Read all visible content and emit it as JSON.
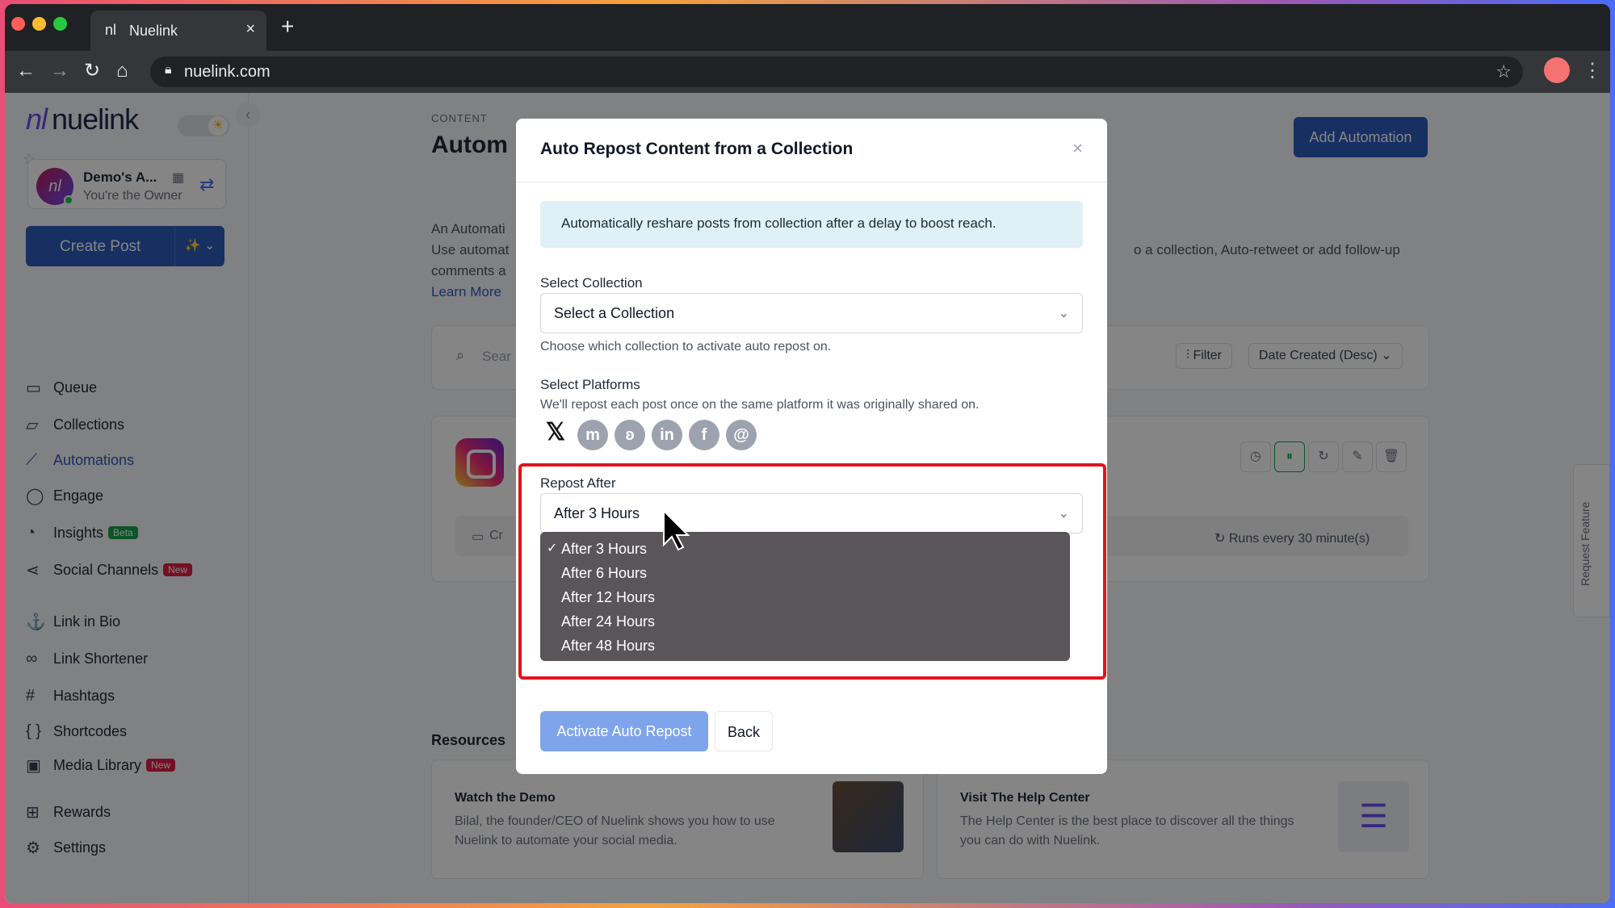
{
  "browser": {
    "tab_title": "Nuelink",
    "tab_icon": "nl",
    "url": "nuelink.com",
    "new_tab": "+",
    "close": "×"
  },
  "sidebar": {
    "logo_mark": "nl",
    "logo_text": "nuelink",
    "account": {
      "name": "Demo's A...",
      "role": "You're the Owner",
      "avatar": "nl"
    },
    "create_post": "Create Post",
    "items": [
      {
        "label": "Queue",
        "icon": "calendar-icon",
        "glyph": "▭"
      },
      {
        "label": "Collections",
        "icon": "folder-icon",
        "glyph": "▱"
      },
      {
        "label": "Automations",
        "icon": "magic-wand-icon",
        "glyph": "⟋",
        "active": true
      },
      {
        "label": "Engage",
        "icon": "chat-icon",
        "glyph": "◯"
      },
      {
        "label": "Insights",
        "icon": "pie-chart-icon",
        "glyph": "◔",
        "badge": "Beta",
        "badge_color": "#16a34a"
      },
      {
        "label": "Social Channels",
        "icon": "share-icon",
        "glyph": "⋖",
        "badge": "New",
        "badge_color": "#e11d48"
      },
      {
        "label": "Link in Bio",
        "icon": "anchor-icon",
        "glyph": "⚓"
      },
      {
        "label": "Link Shortener",
        "icon": "link-icon",
        "glyph": "∞"
      },
      {
        "label": "Hashtags",
        "icon": "hashtag-icon",
        "glyph": "#"
      },
      {
        "label": "Shortcodes",
        "icon": "braces-icon",
        "glyph": "{ }"
      },
      {
        "label": "Media Library",
        "icon": "image-icon",
        "glyph": "▣",
        "badge": "New",
        "badge_color": "#e11d48"
      },
      {
        "label": "Rewards",
        "icon": "gift-icon",
        "glyph": "⊞"
      },
      {
        "label": "Settings",
        "icon": "gear-icon",
        "glyph": "⚙"
      }
    ]
  },
  "main": {
    "crumb": "CONTENT",
    "title": "Autom",
    "add_automation": "Add Automation",
    "intro_line1": "An Automati",
    "intro_line2": "Use automat",
    "intro_line3": "comments a",
    "intro_right": "o a collection, Auto-retweet or add follow-up",
    "learn_more": "Learn More",
    "search_placeholder": "Sear",
    "filter": "Filter",
    "sort": "Date Created (Desc)",
    "card_created": "Cr",
    "runs": "Runs every 30 minute(s)",
    "resources_title": "Resources",
    "resources": [
      {
        "title": "Watch the Demo",
        "desc": "Bilal, the founder/CEO of Nuelink shows you how to use Nuelink to automate your social media."
      },
      {
        "title": "Visit The Help Center",
        "desc": "The Help Center is the best place to discover all the things you can do with Nuelink."
      }
    ],
    "request_feature": "Request Feature"
  },
  "modal": {
    "title": "Auto Repost Content from a Collection",
    "close": "×",
    "info": "Automatically reshare posts from collection after a delay to boost reach.",
    "collection_label": "Select Collection",
    "collection_value": "Select a Collection",
    "collection_help": "Choose which collection to activate auto repost on.",
    "platforms_label": "Select Platforms",
    "platforms_help": "We'll repost each post once on the same platform it was originally shared on.",
    "platforms": [
      {
        "name": "x-icon",
        "glyph": "𝕏"
      },
      {
        "name": "mastodon-icon",
        "glyph": "m"
      },
      {
        "name": "bluesky-icon",
        "glyph": "ʚ"
      },
      {
        "name": "linkedin-icon",
        "glyph": "in"
      },
      {
        "name": "facebook-icon",
        "glyph": "f"
      },
      {
        "name": "threads-icon",
        "glyph": "@"
      }
    ],
    "repost_label": "Repost After",
    "repost_value": "After 3 Hours",
    "options": [
      "After 3 Hours",
      "After 6 Hours",
      "After 12 Hours",
      "After 24 Hours",
      "After 48 Hours"
    ],
    "selected_index": 0,
    "activate": "Activate Auto Repost",
    "back": "Back"
  }
}
